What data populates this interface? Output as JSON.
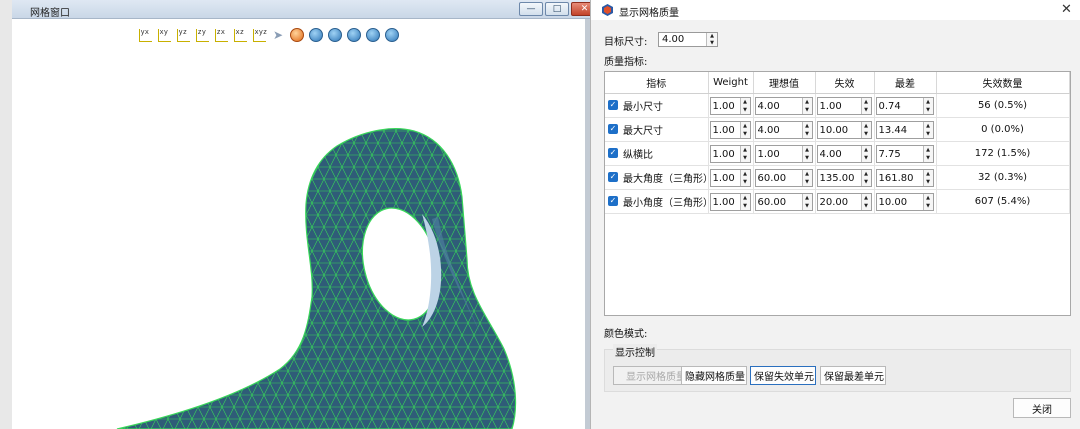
{
  "mesh_window": {
    "title": "网格窗口",
    "buttons": {
      "minimize": "—",
      "maximize": "□",
      "close": "✕"
    },
    "toolbar": [
      {
        "name": "view-yx-icon",
        "glyph": "yx"
      },
      {
        "name": "view-xy-icon",
        "glyph": "xy"
      },
      {
        "name": "view-yz-icon",
        "glyph": "yz"
      },
      {
        "name": "view-zy-icon",
        "glyph": "zy"
      },
      {
        "name": "view-zx-icon",
        "glyph": "zx"
      },
      {
        "name": "view-xz-icon",
        "glyph": "xz"
      },
      {
        "name": "view-iso-icon",
        "glyph": "xyz"
      },
      {
        "name": "select-pointer-icon",
        "glyph": "arrow"
      },
      {
        "name": "rotate-icon",
        "glyph": "round-orange"
      },
      {
        "name": "fit-view-icon",
        "glyph": "round"
      },
      {
        "name": "pan-icon",
        "glyph": "round"
      },
      {
        "name": "zoom-box-icon",
        "glyph": "round"
      },
      {
        "name": "zoom-in-icon",
        "glyph": "round"
      },
      {
        "name": "zoom-out-icon",
        "glyph": "round"
      }
    ],
    "colors": {
      "mesh_face": "#2f5c78",
      "mesh_edge": "#39d65a",
      "hole_face": "#bcd3e6"
    }
  },
  "dialog": {
    "title": "显示网格质量",
    "target_size_label": "目标尺寸:",
    "target_size_value": "4.00",
    "quality_label": "质量指标:",
    "columns": [
      "指标",
      "Weight",
      "理想值",
      "失效",
      "最差",
      "失效数量"
    ],
    "rows": [
      {
        "checked": true,
        "metric": "最小尺寸",
        "weight": "1.00",
        "ideal": "4.00",
        "fail": "1.00",
        "worst": "0.74",
        "fail_count": "56 (0.5%)"
      },
      {
        "checked": true,
        "metric": "最大尺寸",
        "weight": "1.00",
        "ideal": "4.00",
        "fail": "10.00",
        "worst": "13.44",
        "fail_count": "0 (0.0%)"
      },
      {
        "checked": true,
        "metric": "纵横比",
        "weight": "1.00",
        "ideal": "1.00",
        "fail": "4.00",
        "worst": "7.75",
        "fail_count": "172 (1.5%)"
      },
      {
        "checked": true,
        "metric": "最大角度（三角形）",
        "weight": "1.00",
        "ideal": "60.00",
        "fail": "135.00",
        "worst": "161.80",
        "fail_count": "32 (0.3%)"
      },
      {
        "checked": true,
        "metric": "最小角度（三角形）",
        "weight": "1.00",
        "ideal": "60.00",
        "fail": "20.00",
        "worst": "10.00",
        "fail_count": "607 (5.4%)"
      }
    ],
    "color_mode_label": "颜色模式:",
    "display_group_label": "显示控制",
    "buttons": {
      "show_quality": "显示网格质量",
      "hide_quality": "隐藏网格质量",
      "keep_failed": "保留失效单元",
      "keep_worst": "保留最差单元",
      "close": "关闭"
    },
    "accent_color": "#1d6fc8"
  }
}
